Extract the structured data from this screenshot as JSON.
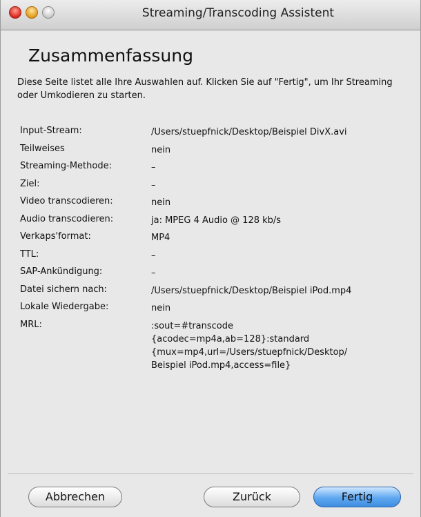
{
  "window": {
    "title": "Streaming/Transcoding Assistent"
  },
  "page": {
    "heading": "Zusammenfassung",
    "intro": "Diese Seite listet alle Ihre Auswahlen auf. Klicken Sie auf \"Fertig\", um Ihr Streaming oder Umkodieren zu starten."
  },
  "summary": {
    "rows": [
      {
        "label": "Input-Stream:",
        "value": "/Users/stuepfnick/Desktop/Beispiel DivX.avi"
      },
      {
        "label": "Teilweises",
        "value": "nein"
      },
      {
        "label": "Streaming-Methode:",
        "value": "–"
      },
      {
        "label": "Ziel:",
        "value": "–"
      },
      {
        "label": "Video transcodieren:",
        "value": "nein"
      },
      {
        "label": "Audio transcodieren:",
        "value": "ja: MPEG 4 Audio @ 128 kb/s"
      },
      {
        "label": "Verkaps'format:",
        "value": "MP4"
      },
      {
        "label": "TTL:",
        "value": "–"
      },
      {
        "label": "SAP-Ankündigung:",
        "value": "–"
      },
      {
        "label": "Datei sichern nach:",
        "value": "/Users/stuepfnick/Desktop/Beispiel iPod.mp4"
      },
      {
        "label": "Lokale Wiedergabe:",
        "value": "nein"
      }
    ],
    "mrl": {
      "label": "MRL:",
      "lines": [
        ":sout=#transcode",
        "{acodec=mp4a,ab=128}:standard",
        "{mux=mp4,url=/Users/stuepfnick/Desktop/",
        "Beispiel iPod.mp4,access=file}"
      ]
    }
  },
  "buttons": {
    "cancel": "Abbrechen",
    "back": "Zurück",
    "finish": "Fertig"
  },
  "colors": {
    "close": "#d9251c",
    "minimize": "#e09a1a",
    "zoom": "#c9c9c9",
    "default_button": "#3f8ee0"
  }
}
